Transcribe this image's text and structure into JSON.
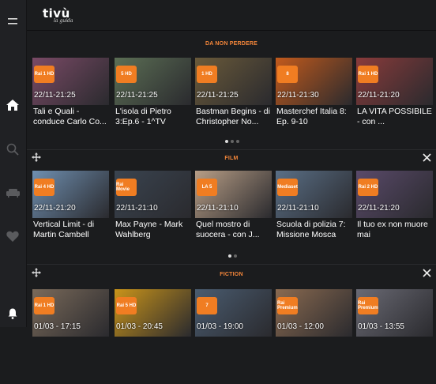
{
  "app": {
    "logo_main": "tivù",
    "logo_sub": "la guida"
  },
  "sidebar": {
    "items": [
      {
        "icon": "menu-icon"
      },
      {
        "icon": "home-icon"
      },
      {
        "icon": "search-icon"
      },
      {
        "icon": "sofa-icon"
      },
      {
        "icon": "heart-icon"
      },
      {
        "icon": "bell-icon"
      }
    ]
  },
  "sections": [
    {
      "title": "DA NON PERDERE",
      "cards": [
        {
          "channel": "Rai 1 HD",
          "time": "22/11-21:25",
          "title": "Tali e Quali - conduce Carlo Co...",
          "color": "#7a4a66"
        },
        {
          "channel": "5 HD",
          "time": "22/11-21:25",
          "title": "L'isola di Pietro 3:Ep.6 - 1^TV",
          "color": "#5c6f55"
        },
        {
          "channel": "1 HD",
          "time": "22/11-21:25",
          "title": "Bastman Begins - di Christopher No...",
          "color": "#6a5a3a"
        },
        {
          "channel": "8",
          "time": "22/11-21:30",
          "title": "Masterchef Italia 8: Ep. 9-10",
          "color": "#c25a1c"
        },
        {
          "channel": "Rai 1 HD",
          "time": "22/11-21:20",
          "title": "LA VITA POSSIBILE - con ...",
          "color": "#8a3b3b"
        }
      ],
      "dots": [
        true,
        false,
        false
      ]
    },
    {
      "title": "FILM",
      "cards": [
        {
          "channel": "Rai 4 HD",
          "time": "22/11-21:20",
          "title": "Vertical Limit - di Martin Cambell",
          "color": "#6f8fb0"
        },
        {
          "channel": "Rai Movie",
          "time": "22/11-21:10",
          "title": "Max Payne - Mark Wahlberg",
          "color": "#3a4450"
        },
        {
          "channel": "LA 5",
          "time": "22/11-21:10",
          "title": "Quel mostro di suocera - con J...",
          "color": "#b89e86"
        },
        {
          "channel": "Mediaset",
          "time": "22/11-21:10",
          "title": "Scuola di polizia 7: Missione Mosca",
          "color": "#5a6f86"
        },
        {
          "channel": "Rai 2 HD",
          "time": "22/11-21:20",
          "title": "Il tuo ex non muore mai",
          "color": "#5a4a6a"
        }
      ],
      "dots": [
        true,
        false
      ]
    },
    {
      "title": "FICTION",
      "cards": [
        {
          "channel": "Rai 1 HD",
          "time": "01/03 - 17:15",
          "title": "",
          "color": "#7a6a5a"
        },
        {
          "channel": "Rai 5 HD",
          "time": "01/03 - 20:45",
          "title": "",
          "color": "#c9941a"
        },
        {
          "channel": "7",
          "time": "01/03 - 19:00",
          "title": "",
          "color": "#4a5c70"
        },
        {
          "channel": "Rai Premium",
          "time": "01/03 - 12:00",
          "title": "",
          "color": "#8a6a50"
        },
        {
          "channel": "Rai Premium",
          "time": "01/03 - 13:55",
          "title": "",
          "color": "#6a6a74"
        }
      ],
      "dots": []
    }
  ],
  "colors": {
    "accent": "#f07d22",
    "section_title": "#f4863a",
    "background": "#1b1c1e"
  }
}
